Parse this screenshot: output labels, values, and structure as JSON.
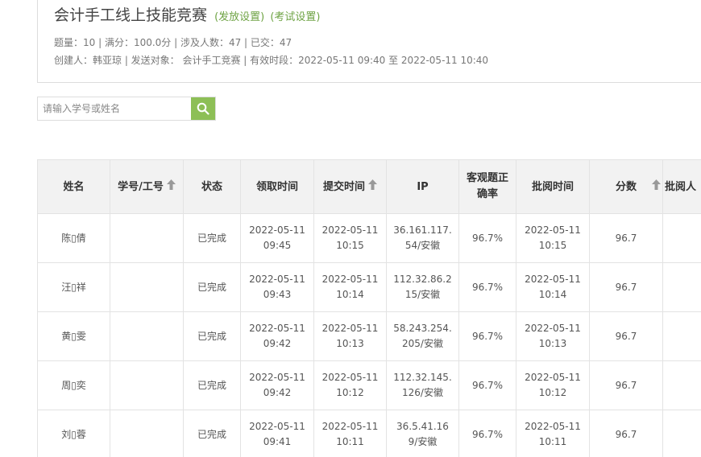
{
  "header": {
    "title": "会计手工线上技能竞赛",
    "link_release": "(发放设置)",
    "link_exam": "(考试设置)",
    "meta_line1": "题量：10 |  满分：100.0分 |  涉及人数：47 | 已交：47",
    "meta_line2": "创建人：韩亚琼 | 发送对象：  会计手工竞赛  |  有效时段：2022-05-11 09:40 至 2022-05-11 10:40"
  },
  "search": {
    "placeholder": "请输入学号或姓名",
    "icon": "search-icon"
  },
  "colors": {
    "accent": "#8dbf56",
    "link": "#6ea344",
    "header_bg": "#f2f2f2",
    "border": "#e3e3e3"
  },
  "table": {
    "columns": [
      {
        "label": "姓名",
        "sortable": false
      },
      {
        "label": "学号/工号",
        "sortable": true
      },
      {
        "label": "状态",
        "sortable": false
      },
      {
        "label": "领取时间",
        "sortable": false
      },
      {
        "label": "提交时间",
        "sortable": true
      },
      {
        "label": "IP",
        "sortable": false
      },
      {
        "label": "客观题正确率",
        "sortable": false
      },
      {
        "label": "批阅时间",
        "sortable": false
      },
      {
        "label": "分数",
        "sortable": true
      },
      {
        "label": "批阅人",
        "sortable": false
      }
    ],
    "rows": [
      {
        "name": "陈▯倩",
        "id": "",
        "status": "已完成",
        "receive": "2022-05-11 09:45",
        "submit": "2022-05-11 10:15",
        "ip": "36.161.117.54/安徽",
        "accuracy": "96.7%",
        "review": "2022-05-11 10:15",
        "score": "96.7",
        "reviewer": ""
      },
      {
        "name": "汪▯祥",
        "id": "",
        "status": "已完成",
        "receive": "2022-05-11 09:43",
        "submit": "2022-05-11 10:14",
        "ip": "112.32.86.215/安徽",
        "accuracy": "96.7%",
        "review": "2022-05-11 10:14",
        "score": "96.7",
        "reviewer": ""
      },
      {
        "name": "黄▯雯",
        "id": "",
        "status": "已完成",
        "receive": "2022-05-11 09:42",
        "submit": "2022-05-11 10:13",
        "ip": "58.243.254.205/安徽",
        "accuracy": "96.7%",
        "review": "2022-05-11 10:13",
        "score": "96.7",
        "reviewer": ""
      },
      {
        "name": "周▯奕",
        "id": "",
        "status": "已完成",
        "receive": "2022-05-11 09:42",
        "submit": "2022-05-11 10:12",
        "ip": "112.32.145.126/安徽",
        "accuracy": "96.7%",
        "review": "2022-05-11 10:12",
        "score": "96.7",
        "reviewer": ""
      },
      {
        "name": "刘▯蓉",
        "id": "",
        "status": "已完成",
        "receive": "2022-05-11 09:41",
        "submit": "2022-05-11 10:11",
        "ip": "36.5.41.169/安徽",
        "accuracy": "96.7%",
        "review": "2022-05-11 10:11",
        "score": "96.7",
        "reviewer": ""
      }
    ]
  }
}
